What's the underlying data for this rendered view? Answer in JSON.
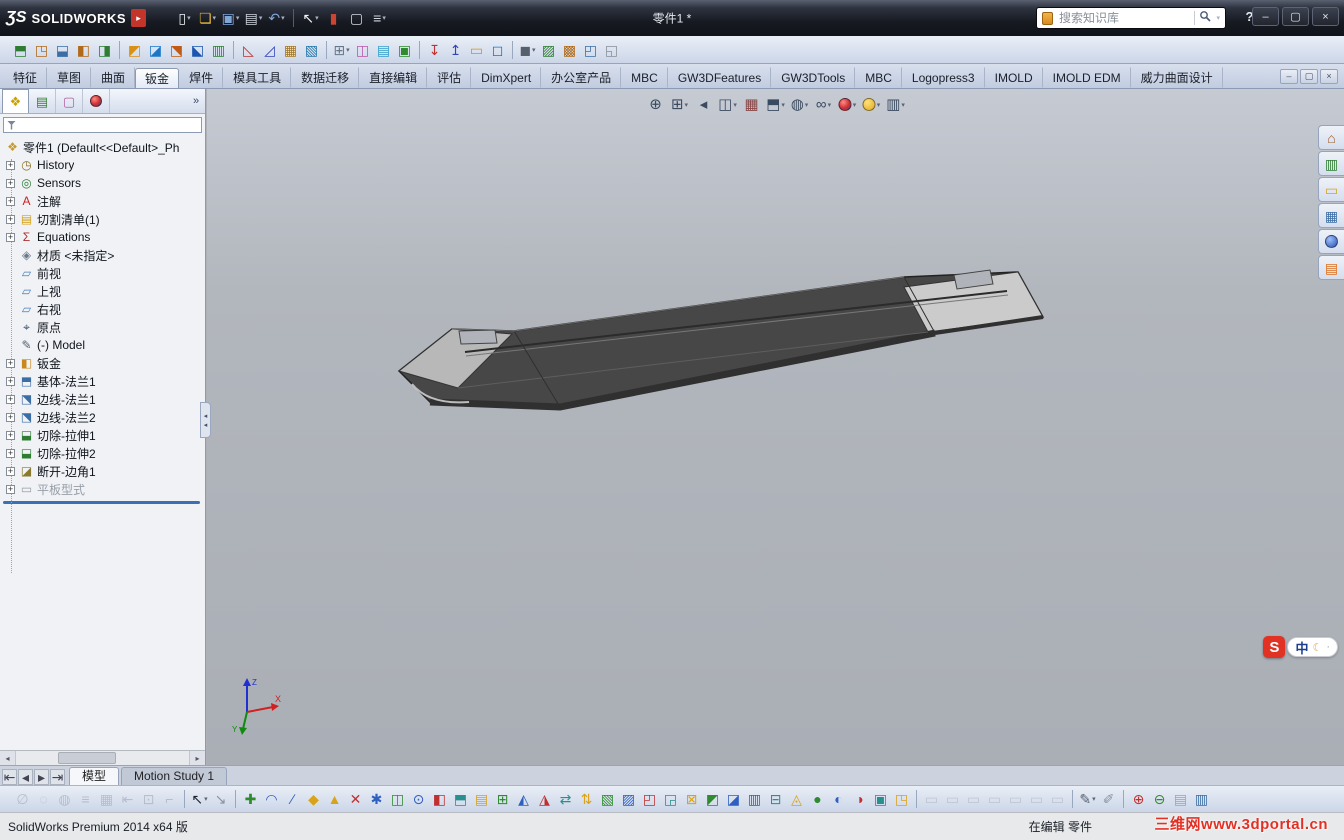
{
  "titlebar": {
    "brand_mark": "ƷS",
    "brand": "SOLIDWORKS",
    "menu_arrow": "▸",
    "title": "零件1 *",
    "search_placeholder": "搜索知识库",
    "help": "?",
    "std_toolbar": [
      {
        "name": "new-button",
        "g": "▯",
        "c": "#f2f4f8",
        "caret": true
      },
      {
        "name": "open-button",
        "g": "❏",
        "c": "#e8b93e",
        "caret": true
      },
      {
        "name": "save-button",
        "g": "▣",
        "c": "#7fa7d8",
        "caret": true
      },
      {
        "name": "print-button",
        "g": "▤",
        "c": "#cfd5de",
        "caret": true
      },
      {
        "name": "undo-button",
        "g": "↶",
        "c": "#7fa7d8",
        "caret": true
      },
      {
        "sep": true
      },
      {
        "name": "select-button",
        "g": "↖",
        "c": "#f2f4f8",
        "caret": true
      },
      {
        "name": "rebuild-button",
        "g": "▮",
        "c": "#cc4433"
      },
      {
        "name": "file-properties-button",
        "g": "▢",
        "c": "#cfd5de"
      },
      {
        "name": "options-button",
        "g": "≡",
        "c": "#cfd5de",
        "caret": true
      }
    ],
    "window_controls": [
      {
        "name": "minimize-button",
        "g": "–"
      },
      {
        "name": "maximize-button",
        "g": "▢"
      },
      {
        "name": "close-button",
        "g": "×"
      }
    ]
  },
  "toolbar2": [
    {
      "g": "⬒",
      "c": "#2e7d32"
    },
    {
      "g": "◳",
      "c": "#b06a1a"
    },
    {
      "g": "⬓",
      "c": "#3a6ea5"
    },
    {
      "g": "◧",
      "c": "#b06a1a"
    },
    {
      "g": "◨",
      "c": "#2e7d32"
    },
    {
      "sep": true
    },
    {
      "g": "◩",
      "c": "#d99114"
    },
    {
      "g": "◪",
      "c": "#1a77c8"
    },
    {
      "g": "⬔",
      "c": "#c05a14"
    },
    {
      "g": "⬕",
      "c": "#1a55b0"
    },
    {
      "g": "▥",
      "c": "#2e7d32"
    },
    {
      "sep": true
    },
    {
      "g": "◺",
      "c": "#bb3333"
    },
    {
      "g": "◿",
      "c": "#3344bb"
    },
    {
      "g": "▦",
      "c": "#a8761a"
    },
    {
      "g": "▧",
      "c": "#2277aa"
    },
    {
      "sep": true
    },
    {
      "g": "⊞",
      "c": "#667788",
      "caret": true
    },
    {
      "g": "◫",
      "c": "#bb55aa"
    },
    {
      "g": "▤",
      "c": "#33a0cc"
    },
    {
      "g": "▣",
      "c": "#2e8b2e"
    },
    {
      "sep": true
    },
    {
      "g": "↧",
      "c": "#bb3333"
    },
    {
      "g": "↥",
      "c": "#3344bb"
    },
    {
      "g": "▭",
      "c": "#d99114"
    },
    {
      "g": "◻",
      "c": "#1a77c8"
    },
    {
      "sep": true
    },
    {
      "g": "◼",
      "c": "#55606c",
      "caret": true
    },
    {
      "g": "▨",
      "c": "#2e7d32"
    },
    {
      "g": "▩",
      "c": "#b06a1a"
    },
    {
      "g": "◰",
      "c": "#3a6ea5"
    },
    {
      "g": "◱",
      "c": "#8a8f98"
    }
  ],
  "command_tabs": [
    {
      "label": "特征"
    },
    {
      "label": "草图"
    },
    {
      "label": "曲面"
    },
    {
      "label": "钣金",
      "active": true
    },
    {
      "label": "焊件"
    },
    {
      "label": "模具工具"
    },
    {
      "label": "数据迁移"
    },
    {
      "label": "直接编辑"
    },
    {
      "label": "评估"
    },
    {
      "label": "DimXpert"
    },
    {
      "label": "办公室产品"
    },
    {
      "label": "MBC"
    },
    {
      "label": "GW3DFeatures"
    },
    {
      "label": "GW3DTools"
    },
    {
      "label": "MBC"
    },
    {
      "label": "Logopress3"
    },
    {
      "label": "IMOLD"
    },
    {
      "label": "IMOLD EDM"
    },
    {
      "label": "威力曲面设计"
    }
  ],
  "command_corner": [
    {
      "name": "toolbar-collapse-button",
      "g": "–"
    },
    {
      "name": "toolbar-float-button",
      "g": "▢"
    },
    {
      "name": "toolbar-close-button",
      "g": "×"
    }
  ],
  "left_panel": {
    "overflow": "»",
    "scroll_left": "◂",
    "scroll_right": "▸",
    "splitter_glyph": "◂"
  },
  "panel_tabs": [
    {
      "name": "featuremanager-tab",
      "g": "❖",
      "c": "#caa200",
      "active": true
    },
    {
      "name": "propertymanager-tab",
      "g": "▤",
      "c": "#3a7e3a"
    },
    {
      "name": "configurationmanager-tab",
      "g": "▢",
      "c": "#b05fa0"
    },
    {
      "name": "displaymanager-tab",
      "ball": "radial-gradient(circle at 35% 30%, #ff8a8a, #d03030 55%, #2a50b0)"
    }
  ],
  "feature_tree": [
    {
      "t": "零件1  (Default<<Default>_Ph",
      "g": "❖",
      "c": "#c79a2e",
      "root": true
    },
    {
      "t": "History",
      "g": "◷",
      "c": "#8a6d1f",
      "e": true
    },
    {
      "t": "Sensors",
      "g": "◎",
      "c": "#2e7d32",
      "e": true
    },
    {
      "t": "注解",
      "g": "A",
      "c": "#cc2222",
      "e": true
    },
    {
      "t": "切割清单(1)",
      "g": "▤",
      "c": "#d4a017",
      "e": true
    },
    {
      "t": "Equations",
      "g": "Σ",
      "c": "#b03030",
      "e": true
    },
    {
      "t": "材质 <未指定>",
      "g": "◈",
      "c": "#6a7a8a"
    },
    {
      "t": "前视",
      "g": "▱",
      "c": "#4a7ebb"
    },
    {
      "t": "上视",
      "g": "▱",
      "c": "#4a7ebb"
    },
    {
      "t": "右视",
      "g": "▱",
      "c": "#4a7ebb"
    },
    {
      "t": "原点",
      "g": "⌖",
      "c": "#334a66"
    },
    {
      "t": "(-) Model",
      "g": "✎",
      "c": "#55616e"
    },
    {
      "t": "钣金",
      "g": "◧",
      "c": "#c8881a",
      "e": true
    },
    {
      "t": "基体-法兰1",
      "g": "⬒",
      "c": "#3a6ea5",
      "e": true
    },
    {
      "t": "边线-法兰1",
      "g": "⬔",
      "c": "#3a6ea5",
      "e": true
    },
    {
      "t": "边线-法兰2",
      "g": "⬔",
      "c": "#3a6ea5",
      "e": true
    },
    {
      "t": "切除-拉伸1",
      "g": "⬓",
      "c": "#2e7d32",
      "e": true
    },
    {
      "t": "切除-拉伸2",
      "g": "⬓",
      "c": "#2e7d32",
      "e": true
    },
    {
      "t": "断开-边角1",
      "g": "◪",
      "c": "#8a7a2e",
      "e": true
    },
    {
      "t": "平板型式",
      "g": "▭",
      "c": "#98a0a8",
      "e": true,
      "gray": true
    }
  ],
  "headsup": [
    {
      "name": "zoom-fit-button",
      "g": "⊕",
      "c": "#3a4a60"
    },
    {
      "name": "zoom-area-button",
      "g": "⊞",
      "c": "#3a4a60",
      "caret": true
    },
    {
      "name": "previous-view-button",
      "g": "◂",
      "c": "#3a4a60"
    },
    {
      "name": "section-view-button",
      "g": "◫",
      "c": "#3a4a60",
      "caret": true
    },
    {
      "name": "annotation-view-button",
      "g": "▦",
      "c": "#884444"
    },
    {
      "name": "view-orientation-button",
      "g": "⬒",
      "c": "#3a4a60",
      "caret": true
    },
    {
      "name": "display-style-button",
      "g": "◍",
      "c": "#3a4a60",
      "caret": true
    },
    {
      "name": "hide-show-items-button",
      "g": "∞",
      "c": "#3a4a60",
      "caret": true
    },
    {
      "name": "edit-appearance-button",
      "ball": "radial-gradient(circle at 35% 30%, #ff8a8a, #d03030 55%, #2a50b0)",
      "caret": true
    },
    {
      "name": "apply-scene-button",
      "ball": "radial-gradient(circle at 35% 30%, #ffe27a, #e0a820)",
      "caret": true
    },
    {
      "name": "view-settings-button",
      "g": "▥",
      "c": "#3a4a60",
      "caret": true
    }
  ],
  "taskpane": [
    {
      "name": "solidworks-resources-tab",
      "g": "⌂",
      "c": "#9a5b2a"
    },
    {
      "name": "design-library-tab",
      "g": "▥",
      "c": "#2e7d32"
    },
    {
      "name": "file-explorer-tab",
      "g": "▭",
      "c": "#d9a21b"
    },
    {
      "name": "view-palette-tab",
      "g": "▦",
      "c": "#3a6ea5"
    },
    {
      "name": "appearances-tab",
      "ball": "radial-gradient(circle at 35% 30%, #9ec0ff, #2a50b0)"
    },
    {
      "name": "custom-properties-tab",
      "g": "▤",
      "c": "#e07020"
    }
  ],
  "triad": {
    "x": "X",
    "y": "Y",
    "z": "Z"
  },
  "ime": {
    "logo": "S",
    "lang": "中",
    "moon": "☾",
    "dot": "·"
  },
  "bottom_tabs": {
    "nav": [
      {
        "name": "tab-scroll-first-button",
        "g": "⇤"
      },
      {
        "name": "tab-scroll-prev-button",
        "g": "◂"
      },
      {
        "name": "tab-scroll-next-button",
        "g": "▸"
      },
      {
        "name": "tab-scroll-last-button",
        "g": "⇥"
      }
    ],
    "tabs": [
      {
        "label": "模型",
        "active": true
      },
      {
        "label": "Motion Study 1",
        "active": false
      }
    ]
  },
  "bottom_toolbar": [
    {
      "g": "∅",
      "c": "#9aa2ae",
      "disabled": true
    },
    {
      "g": "◌",
      "c": "#9aa2ae",
      "disabled": true
    },
    {
      "g": "◍",
      "c": "#9aa2ae",
      "disabled": true
    },
    {
      "g": "≡",
      "c": "#9aa2ae",
      "disabled": true
    },
    {
      "g": "▦",
      "c": "#9aa2ae",
      "disabled": true
    },
    {
      "g": "⇤",
      "c": "#9aa2ae",
      "disabled": true
    },
    {
      "g": "⊡",
      "c": "#9aa2ae",
      "disabled": true
    },
    {
      "g": "⌐",
      "c": "#9aa2ae",
      "disabled": true
    },
    {
      "sep": true
    },
    {
      "g": "↖",
      "c": "#1d2430",
      "caret": true
    },
    {
      "g": "↘",
      "c": "#8a93a0"
    },
    {
      "sep": true
    },
    {
      "g": "✚",
      "c": "#2e8b2e"
    },
    {
      "g": "◠",
      "c": "#2f5fbf"
    },
    {
      "g": "∕",
      "c": "#2f5fbf"
    },
    {
      "g": "◆",
      "c": "#d9a21b"
    },
    {
      "g": "▲",
      "c": "#d9a21b"
    },
    {
      "g": "✕",
      "c": "#c03030"
    },
    {
      "g": "✱",
      "c": "#2f5fbf"
    },
    {
      "g": "◫",
      "c": "#2e8b2e"
    },
    {
      "g": "⊙",
      "c": "#2f5fbf"
    },
    {
      "g": "◧",
      "c": "#c03030"
    },
    {
      "g": "⬒",
      "c": "#2a8f8f"
    },
    {
      "g": "▤",
      "c": "#d9a21b"
    },
    {
      "g": "⊞",
      "c": "#2e8b2e"
    },
    {
      "g": "◭",
      "c": "#2f5fbf"
    },
    {
      "g": "◮",
      "c": "#c03030"
    },
    {
      "g": "⇄",
      "c": "#2a8f8f"
    },
    {
      "g": "⇅",
      "c": "#d9a21b"
    },
    {
      "g": "▧",
      "c": "#2e8b2e"
    },
    {
      "g": "▨",
      "c": "#2f5fbf"
    },
    {
      "g": "◰",
      "c": "#c03030"
    },
    {
      "g": "◲",
      "c": "#2a8f8f"
    },
    {
      "g": "⊠",
      "c": "#d9a21b"
    },
    {
      "g": "◩",
      "c": "#2e8b2e"
    },
    {
      "g": "◪",
      "c": "#2f5fbf"
    },
    {
      "g": "▥",
      "c": "#c03030"
    },
    {
      "g": "⊟",
      "c": "#2a8f8f"
    },
    {
      "g": "◬",
      "c": "#d9a21b"
    },
    {
      "g": "●",
      "c": "#2e8b2e"
    },
    {
      "g": "◐",
      "c": "#2f5fbf"
    },
    {
      "g": "◑",
      "c": "#c03030"
    },
    {
      "g": "▣",
      "c": "#2a8f8f"
    },
    {
      "g": "◳",
      "c": "#d9a21b"
    },
    {
      "sep": true
    },
    {
      "g": "▭",
      "c": "#a7aeb8",
      "disabled": true
    },
    {
      "g": "▭",
      "c": "#a7aeb8",
      "disabled": true
    },
    {
      "g": "▭",
      "c": "#a7aeb8",
      "disabled": true
    },
    {
      "g": "▭",
      "c": "#a7aeb8",
      "disabled": true
    },
    {
      "g": "▭",
      "c": "#a7aeb8",
      "disabled": true
    },
    {
      "g": "▭",
      "c": "#a7aeb8",
      "disabled": true
    },
    {
      "g": "▭",
      "c": "#a7aeb8",
      "disabled": true
    },
    {
      "sep": true
    },
    {
      "g": "✎",
      "c": "#55616e",
      "caret": true
    },
    {
      "g": "✐",
      "c": "#8a93a0"
    },
    {
      "sep": true
    },
    {
      "g": "⊕",
      "c": "#c03030"
    },
    {
      "g": "⊖",
      "c": "#2e8b2e"
    },
    {
      "g": "▤",
      "c": "#d9a21b"
    },
    {
      "g": "▥",
      "c": "#3a6ea5"
    }
  ],
  "status": {
    "left": "SolidWorks Premium 2014 x64 版",
    "right": "在编辑 零件",
    "watermark": "三维网www.3dportal.cn"
  }
}
